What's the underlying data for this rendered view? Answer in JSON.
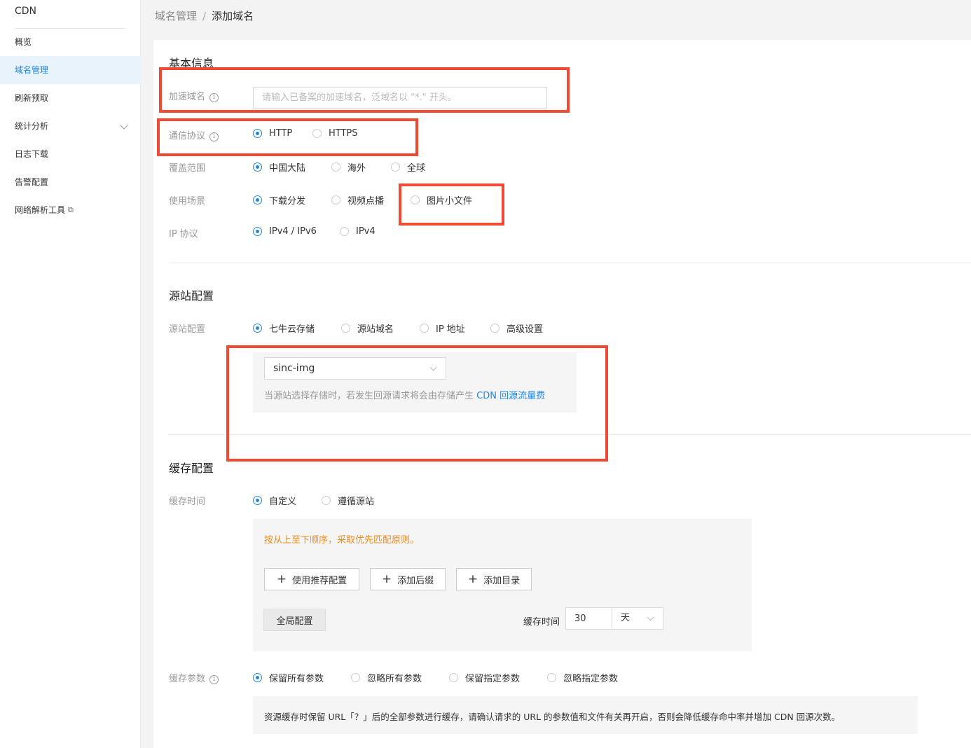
{
  "sidebar": {
    "title": "CDN",
    "items": [
      {
        "label": "概览"
      },
      {
        "label": "域名管理"
      },
      {
        "label": "刷新预取"
      },
      {
        "label": "统计分析"
      },
      {
        "label": "日志下载"
      },
      {
        "label": "告警配置"
      },
      {
        "label": "网络解析工具"
      }
    ]
  },
  "breadcrumb": {
    "parent": "域名管理",
    "separator": "/",
    "current": "添加域名"
  },
  "basic": {
    "title": "基本信息",
    "domain_label": "加速域名",
    "domain_placeholder": "请输入已备案的加速域名，泛域名以 \"*.\" 开头。",
    "protocol_label": "通信协议",
    "protocol_options": [
      "HTTP",
      "HTTPS"
    ],
    "coverage_label": "覆盖范围",
    "coverage_options": [
      "中国大陆",
      "海外",
      "全球"
    ],
    "scene_label": "使用场景",
    "scene_options": [
      "下载分发",
      "视频点播",
      "图片小文件"
    ],
    "ip_label": "IP 协议",
    "ip_options": [
      "IPv4 / IPv6",
      "IPv4"
    ]
  },
  "origin": {
    "title": "源站配置",
    "label": "源站配置",
    "options": [
      "七牛云存储",
      "源站域名",
      "IP 地址",
      "高级设置"
    ],
    "bucket_value": "sinc-img",
    "note_prefix": "当源站选择存储时，若发生回源请求将会由存储产生 ",
    "note_link": "CDN 回源流量费"
  },
  "cache": {
    "title": "缓存配置",
    "time_label": "缓存时间",
    "time_options": [
      "自定义",
      "遵循源站"
    ],
    "rule_note": "按从上至下顺序，采取优先匹配原则。",
    "btn_recommend": "使用推荐配置",
    "btn_suffix": "添加后缀",
    "btn_dir": "添加目录",
    "btn_global": "全局配置",
    "cache_time_label": "缓存时间",
    "cache_time_value": "30",
    "cache_time_unit": "天",
    "param_label": "缓存参数",
    "param_options": [
      "保留所有参数",
      "忽略所有参数",
      "保留指定参数",
      "忽略指定参数"
    ],
    "param_desc": "资源缓存时保留 URL「？」后的全部参数进行缓存，请确认请求的 URL 的参数值和文件有关再开启，否则会降低缓存命中率并增加 CDN 回源次数。"
  },
  "colors": {
    "accent": "#1e88e5",
    "highlight": "#f04a34",
    "warning": "#f08c1c"
  }
}
